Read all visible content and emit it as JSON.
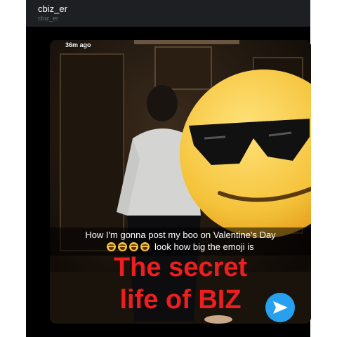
{
  "header": {
    "username": "cbiz_er",
    "handle": "cbiz_er"
  },
  "story": {
    "timestamp": "36m ago",
    "caption_line1": "How I'm gonna post my boo on Valentine's Day",
    "caption_line2": "look how big the emoji is",
    "caption_emoji": "face-with-tears-of-joy",
    "caption_emoji_count": 4,
    "overlay_line1": "The secret",
    "overlay_line2": "life of BIZ",
    "sticker": "smiling-face-with-sunglasses-emoji"
  },
  "colors": {
    "overlay_text": "#ee1e1e",
    "share_button": "#27a0f0",
    "emoji_yellow": "#f5c33b"
  }
}
